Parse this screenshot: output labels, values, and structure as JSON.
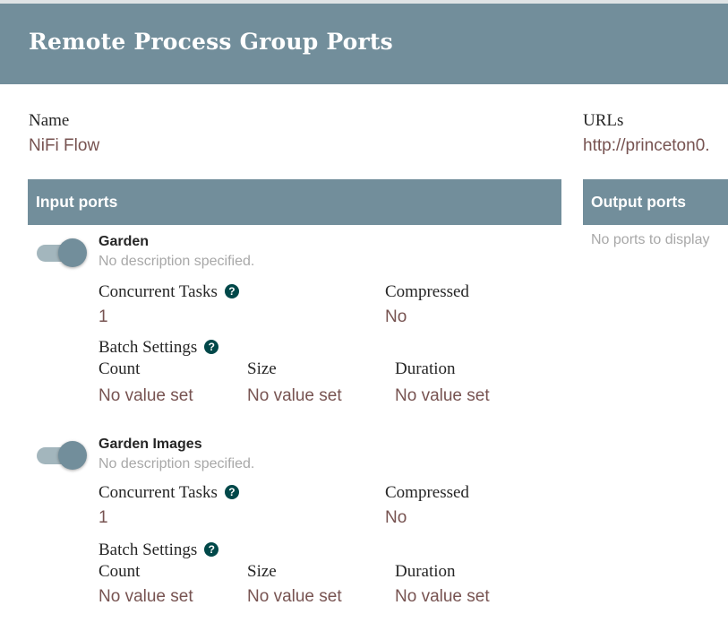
{
  "dialog": {
    "title": "Remote Process Group Ports"
  },
  "details": {
    "name_label": "Name",
    "name_value": "NiFi Flow",
    "urls_label": "URLs",
    "urls_value": "http://princeton0."
  },
  "input_ports": {
    "header": "Input ports",
    "ports": [
      {
        "name": "Garden",
        "description": "No description specified.",
        "enabled": true,
        "concurrent_tasks_label": "Concurrent Tasks",
        "concurrent_tasks_value": "1",
        "compressed_label": "Compressed",
        "compressed_value": "No",
        "batch_settings_label": "Batch Settings",
        "count_label": "Count",
        "count_value": "No value set",
        "size_label": "Size",
        "size_value": "No value set",
        "duration_label": "Duration",
        "duration_value": "No value set"
      },
      {
        "name": "Garden Images",
        "description": "No description specified.",
        "enabled": true,
        "concurrent_tasks_label": "Concurrent Tasks",
        "concurrent_tasks_value": "1",
        "compressed_label": "Compressed",
        "compressed_value": "No",
        "batch_settings_label": "Batch Settings",
        "count_label": "Count",
        "count_value": "No value set",
        "size_label": "Size",
        "size_value": "No value set",
        "duration_label": "Duration",
        "duration_value": "No value set"
      }
    ]
  },
  "output_ports": {
    "header": "Output ports",
    "empty_message": "No ports to display"
  },
  "icons": {
    "help": "question-circle-icon",
    "toggle": "toggle-switch"
  },
  "colors": {
    "header_bg": "#728e9b",
    "value_text": "#775351",
    "muted_text": "#a8a8a8",
    "help_icon": "#004849"
  }
}
